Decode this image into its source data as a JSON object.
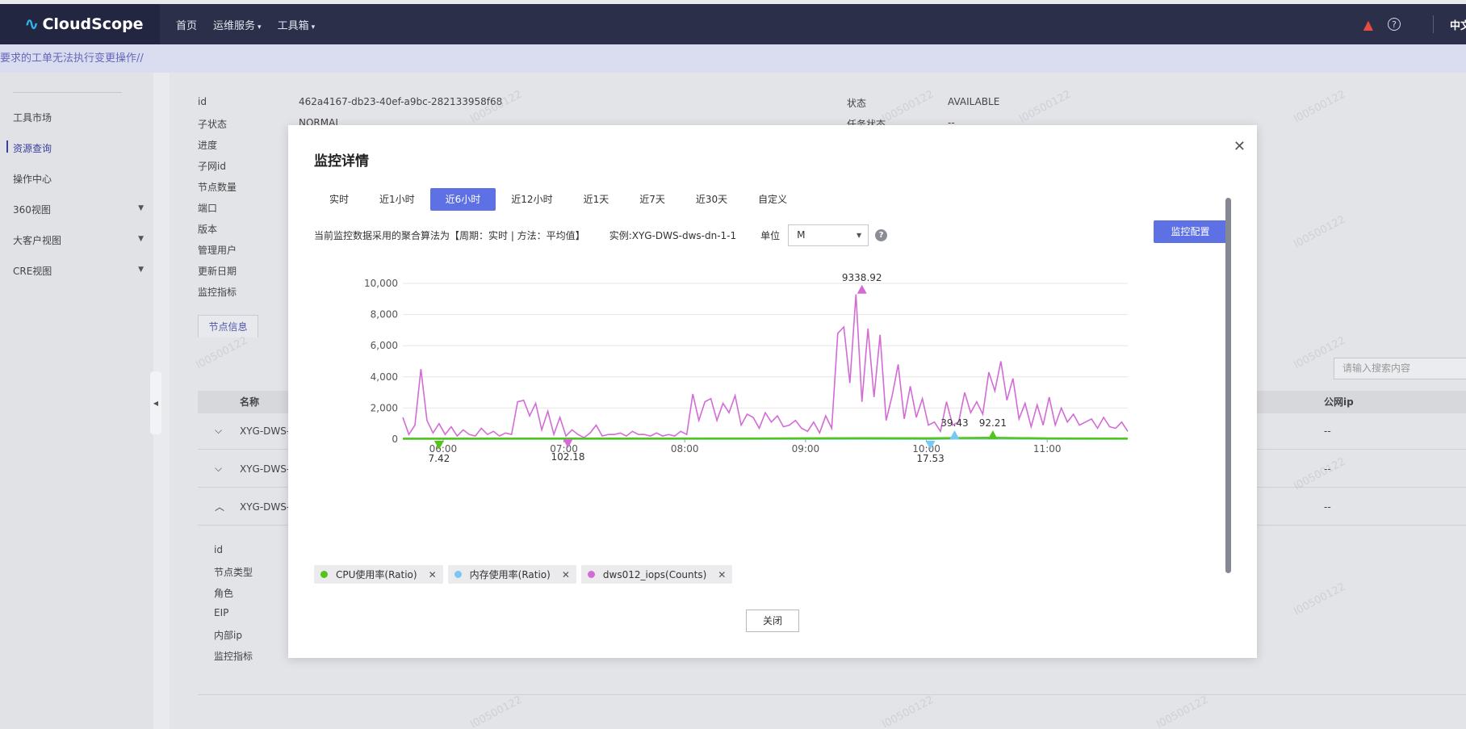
{
  "header": {
    "brand": "CloudScope",
    "nav": [
      "首页",
      "运维服务",
      "工具箱"
    ],
    "lang": "中文"
  },
  "notice": "要求的工单无法执行变更操作//",
  "sidebar": {
    "items": [
      {
        "label": "工具市场",
        "active": false,
        "expandable": false
      },
      {
        "label": "资源查询",
        "active": true,
        "expandable": false
      },
      {
        "label": "操作中心",
        "active": false,
        "expandable": false
      },
      {
        "label": "360视图",
        "active": false,
        "expandable": true
      },
      {
        "label": "大客户视图",
        "active": false,
        "expandable": true
      },
      {
        "label": "CRE视图",
        "active": false,
        "expandable": true
      }
    ]
  },
  "background": {
    "fields_left": [
      "id",
      "子状态",
      "进度",
      "子网id",
      "节点数量",
      "端口",
      "版本",
      "管理用户",
      "更新日期",
      "监控指标"
    ],
    "id_value": "462a4167-db23-40ef-a9bc-282133958f68",
    "substate_value": "NORMAL",
    "status_label": "状态",
    "status_value": "AVAILABLE",
    "task_status_label": "任务状态",
    "task_status_value": "--",
    "node_tab": "节点信息",
    "search_placeholder": "请输入搜索内容",
    "table_name_header": "名称",
    "table_public_ip_header": "公网ip",
    "rows": [
      "XYG-DWS-",
      "XYG-DWS-",
      "XYG-DWS-"
    ],
    "row_ip": "--",
    "detail_fields": [
      "id",
      "节点类型",
      "角色",
      "EIP",
      "内部ip",
      "监控指标"
    ],
    "watermark": "l00500122"
  },
  "modal": {
    "title": "监控详情",
    "tabs": [
      "实时",
      "近1小时",
      "近6小时",
      "近12小时",
      "近1天",
      "近7天",
      "近30天",
      "自定义"
    ],
    "active_tab": "近6小时",
    "aggregation_text": "当前监控数据采用的聚合算法为【周期：实时 | 方法：平均值】",
    "instance_text": "实例:XYG-DWS-dws-dn-1-1",
    "unit_label": "单位",
    "unit_value": "M",
    "config_button": "监控配置",
    "close_button": "关闭",
    "legend": [
      {
        "name": "CPU使用率(Ratio)",
        "color": "#52c41a"
      },
      {
        "name": "内存使用率(Ratio)",
        "color": "#78c8f0"
      },
      {
        "name": "dws012_iops(Counts)",
        "color": "#d36bd6"
      }
    ]
  },
  "chart_data": {
    "type": "line",
    "x_ticks": [
      "06:00",
      "07:00",
      "08:00",
      "09:00",
      "10:00",
      "11:00"
    ],
    "x_range": [
      "05:40",
      "11:40"
    ],
    "y_ticks": [
      "0",
      "2,000",
      "4,000",
      "6,000",
      "8,000",
      "10,000"
    ],
    "ylim": [
      0,
      10000
    ],
    "grid": true,
    "markers": [
      {
        "label": "9338.92",
        "series": "dws012_iops(Counts)",
        "kind": "max",
        "time": "09:28"
      },
      {
        "label": "102.18",
        "series": "dws012_iops(Counts)",
        "kind": "min",
        "time": "07:02"
      },
      {
        "label": "7.42",
        "series": "CPU使用率(Ratio)",
        "kind": "min",
        "time": "05:58"
      },
      {
        "label": "92.21",
        "series": "CPU使用率(Ratio)",
        "kind": "max",
        "time": "10:33"
      },
      {
        "label": "17.53",
        "series": "内存使用率(Ratio)",
        "kind": "min",
        "time": "10:02"
      },
      {
        "label": "39.43",
        "series": "内存使用率(Ratio)",
        "kind": "max",
        "time": "10:14"
      }
    ],
    "series": [
      {
        "name": "CPU使用率(Ratio)",
        "color": "#52c41a",
        "values_note": "",
        "x": [
          "05:40",
          "06:30",
          "07:30",
          "08:30",
          "09:30",
          "10:00",
          "10:33",
          "11:00",
          "11:40"
        ],
        "values": [
          30,
          35,
          40,
          45,
          60,
          55,
          92,
          50,
          40
        ]
      },
      {
        "name": "内存使用率(Ratio)",
        "color": "#78c8f0",
        "x": [
          "05:40",
          "06:30",
          "07:30",
          "08:30",
          "09:30",
          "10:02",
          "10:14",
          "11:00",
          "11:40"
        ],
        "values": [
          25,
          25,
          26,
          27,
          28,
          18,
          39,
          28,
          27
        ]
      },
      {
        "name": "dws012_iops(Counts)",
        "color": "#d36bd6",
        "x": [
          "05:40",
          "05:43",
          "05:46",
          "05:49",
          "05:52",
          "05:55",
          "05:58",
          "06:01",
          "06:04",
          "06:07",
          "06:10",
          "06:13",
          "06:16",
          "06:19",
          "06:22",
          "06:25",
          "06:28",
          "06:31",
          "06:34",
          "06:37",
          "06:40",
          "06:43",
          "06:46",
          "06:49",
          "06:52",
          "06:55",
          "06:58",
          "07:01",
          "07:04",
          "07:07",
          "07:10",
          "07:13",
          "07:16",
          "07:19",
          "07:22",
          "07:25",
          "07:28",
          "07:31",
          "07:34",
          "07:37",
          "07:40",
          "07:43",
          "07:46",
          "07:49",
          "07:52",
          "07:55",
          "07:58",
          "08:01",
          "08:04",
          "08:07",
          "08:10",
          "08:13",
          "08:16",
          "08:19",
          "08:22",
          "08:25",
          "08:28",
          "08:31",
          "08:34",
          "08:37",
          "08:40",
          "08:43",
          "08:46",
          "08:49",
          "08:52",
          "08:55",
          "08:58",
          "09:01",
          "09:04",
          "09:07",
          "09:10",
          "09:13",
          "09:16",
          "09:19",
          "09:22",
          "09:25",
          "09:28",
          "09:31",
          "09:34",
          "09:37",
          "09:40",
          "09:43",
          "09:46",
          "09:49",
          "09:52",
          "09:55",
          "09:58",
          "10:01",
          "10:04",
          "10:07",
          "10:10",
          "10:13",
          "10:16",
          "10:19",
          "10:22",
          "10:25",
          "10:28",
          "10:31",
          "10:34",
          "10:37",
          "10:40",
          "10:43",
          "10:46",
          "10:49",
          "10:52",
          "10:55",
          "10:58",
          "11:01",
          "11:04",
          "11:07",
          "11:10",
          "11:13",
          "11:16",
          "11:19",
          "11:22",
          "11:25",
          "11:28",
          "11:31",
          "11:34",
          "11:37",
          "11:40"
        ],
        "values": [
          1400,
          300,
          900,
          4500,
          1200,
          400,
          1000,
          300,
          800,
          200,
          600,
          300,
          200,
          700,
          300,
          500,
          200,
          400,
          300,
          2400,
          2500,
          1500,
          2300,
          600,
          1800,
          300,
          1400,
          200,
          600,
          300,
          100,
          400,
          900,
          200,
          300,
          300,
          400,
          200,
          500,
          300,
          300,
          200,
          400,
          200,
          300,
          200,
          500,
          300,
          2900,
          1200,
          2400,
          2600,
          1200,
          2300,
          1700,
          2800,
          900,
          1600,
          1400,
          700,
          1700,
          1100,
          1500,
          800,
          900,
          1200,
          700,
          500,
          1100,
          400,
          1500,
          700,
          6800,
          7200,
          3600,
          9300,
          2400,
          7100,
          2700,
          6700,
          1200,
          2800,
          4800,
          1300,
          3400,
          1400,
          2600,
          900,
          1100,
          500,
          2400,
          900,
          1100,
          3000,
          1700,
          2400,
          1600,
          4300,
          3100,
          5000,
          2500,
          3900,
          1300,
          2300,
          800,
          2200,
          900,
          2700,
          900,
          2000,
          1100,
          1600,
          900,
          1100,
          1300,
          700,
          1400,
          800,
          700,
          1100,
          500
        ]
      }
    ]
  }
}
